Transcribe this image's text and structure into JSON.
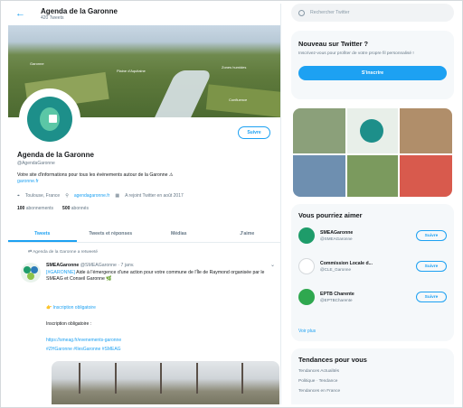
{
  "header": {
    "back_icon": "arrow-left-icon",
    "name": "Agenda de la Garonne",
    "tweets_count": "420 Tweets"
  },
  "banner": {
    "labels": [
      "Garonne",
      "Plaine d'Aquitaine",
      "Zones humides",
      "Confluence"
    ]
  },
  "profile": {
    "follow_label": "Suivre",
    "name": "Agenda de la Garonne",
    "handle": "@AgendaGaronne",
    "bio": "Votre site d'informations pour tous les événements autour de la Garonne",
    "bio_link": "garonne.fr",
    "location": "Toulouse, France",
    "website": "agendagaronne.fr",
    "joined": "A rejoint Twitter en août 2017",
    "following": "100",
    "following_label": "abonnements",
    "followers": "500",
    "followers_label": "abonnés"
  },
  "tabs": [
    {
      "label": "Tweets"
    },
    {
      "label": "Tweets et réponses"
    },
    {
      "label": "Médias"
    },
    {
      "label": "J'aime"
    }
  ],
  "tweet": {
    "pinned": "Agenda de la Garonne a retweeté",
    "author": "SMEAGaronne",
    "handle": "@SMEAGaronne · 7 janv.",
    "body_prefix": "[#GARONNE]",
    "body": "Aide à l'émergence d'une action pour votre commune de l'Île de Raymond organisée par le SMEAG et Conseil Garonne",
    "link1": "Inscription obligatoire",
    "line2": "Inscription obligatoire :",
    "link2": "https://smeag.fr/evenements-garonne",
    "link3": "#ZHGaronne #IlesGaronne #SMEAG"
  },
  "search": {
    "placeholder": "Rechercher Twitter"
  },
  "new_card": {
    "title": "Nouveau sur Twitter ?",
    "text": "Inscrivez-vous pour profiter de votre propre fil personnalisé !",
    "signup": "S'inscrire"
  },
  "who_to_follow": {
    "title": "Vous pourriez aimer",
    "accounts": [
      {
        "name": "SMEAGaronne",
        "handle": "@SMEAGaronne",
        "button": "Suivre",
        "color": "#1e9c6a"
      },
      {
        "name": "Commission Locale d...",
        "handle": "@CLE_Garonne",
        "button": "Suivre",
        "color": "#2b7bb9"
      },
      {
        "name": "EPTB Charente",
        "handle": "@EPTBCharente",
        "button": "Suivre",
        "color": "#2fa84f"
      }
    ],
    "more": "Voir plus"
  },
  "trends": {
    "title": "Tendances pour vous",
    "items": [
      "Tendances Actualités",
      "Politique · Tendance",
      "Tendances en France"
    ]
  },
  "colors": {
    "accent": "#1da1f2",
    "muted": "#657786"
  }
}
